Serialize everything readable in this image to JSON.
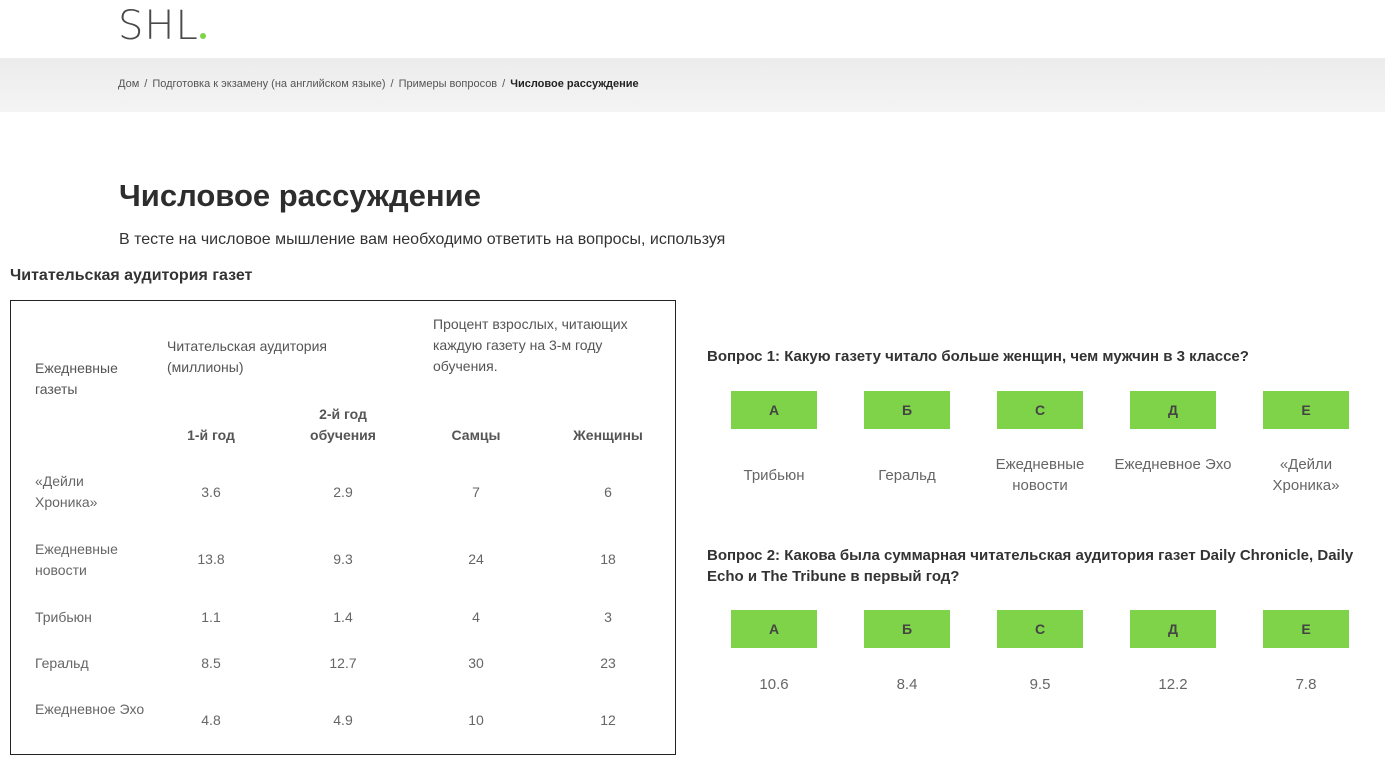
{
  "logo": {
    "text": "SHL"
  },
  "breadcrumb": {
    "items": [
      "Дом",
      "Подготовка к экзамену (на английском языке)",
      "Примеры вопросов"
    ],
    "current": "Числовое рассуждение",
    "separator": "/"
  },
  "page": {
    "title": "Числовое рассуждение",
    "intro": "В тесте на числовое мышление вам необходимо ответить на вопросы, используя"
  },
  "table": {
    "title": "Читательская аудитория газет",
    "col0_header": "Ежедневные газеты",
    "group1_header": "Читательская аудитория (миллионы)",
    "group2_header": "Процент взрослых, читающих каждую газету на 3-м году обучения.",
    "sub_headers": [
      "1-й год",
      "2-й год обучения",
      "Самцы",
      "Женщины"
    ],
    "rows": [
      {
        "name": "«Дейли Хроника»",
        "values": [
          "3.6",
          "2.9",
          "7",
          "6"
        ]
      },
      {
        "name": "Ежедневные новости",
        "values": [
          "13.8",
          "9.3",
          "24",
          "18"
        ]
      },
      {
        "name": "Трибьюн",
        "values": [
          "1.1",
          "1.4",
          "4",
          "3"
        ]
      },
      {
        "name": "Геральд",
        "values": [
          "8.5",
          "12.7",
          "30",
          "23"
        ]
      },
      {
        "name": "Ежедневное Эхо",
        "values": [
          "4.8",
          "4.9",
          "10",
          "12"
        ]
      }
    ]
  },
  "questions": [
    {
      "text": "Вопрос 1: Какую газету читало больше женщин, чем мужчин в 3 классе?",
      "options": [
        {
          "letter": "А",
          "answer": "Трибьюн"
        },
        {
          "letter": "Б",
          "answer": "Геральд"
        },
        {
          "letter": "С",
          "answer": "Ежедневные новости"
        },
        {
          "letter": "Д",
          "answer": "Ежедневное Эхо"
        },
        {
          "letter": "Е",
          "answer": "«Дейли Хроника»"
        }
      ]
    },
    {
      "text": "Вопрос 2: Какова была суммарная читательская аудитория газет Daily Chronicle, Daily Echo и The Tribune в первый год?",
      "options": [
        {
          "letter": "А",
          "answer": "10.6"
        },
        {
          "letter": "Б",
          "answer": "8.4"
        },
        {
          "letter": "С",
          "answer": "9.5"
        },
        {
          "letter": "Д",
          "answer": "12.2"
        },
        {
          "letter": "Е",
          "answer": "7.8"
        }
      ]
    }
  ],
  "colors": {
    "accent": "#7ed348",
    "text": "#333333",
    "muted": "#666666"
  }
}
